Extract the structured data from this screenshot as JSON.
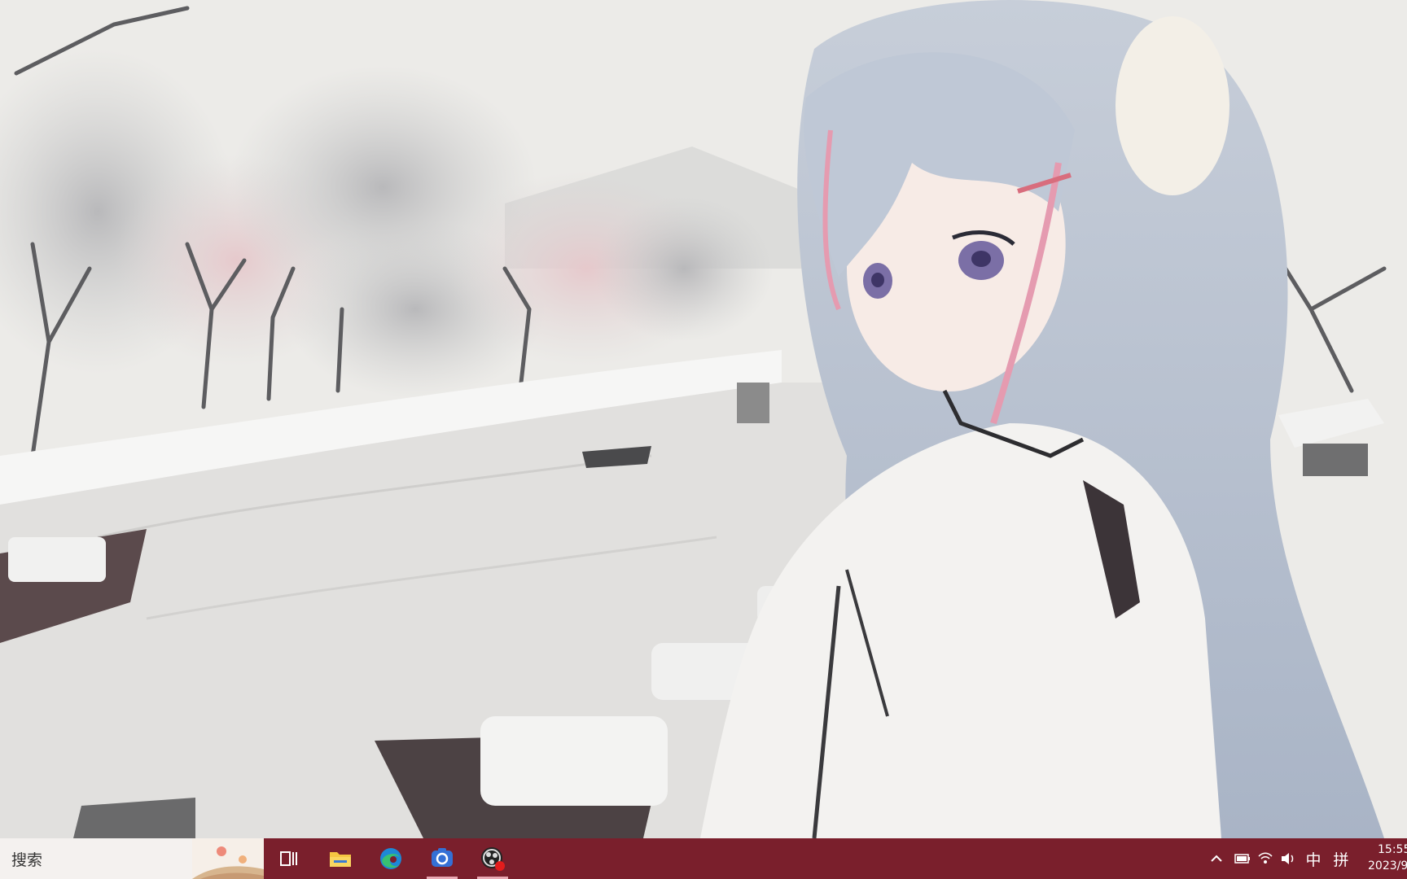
{
  "taskbar": {
    "search_placeholder": "搜索",
    "apps": [
      {
        "name": "task-view",
        "icon": "task-view-icon"
      },
      {
        "name": "file-explorer",
        "icon": "folder-icon"
      },
      {
        "name": "edge",
        "icon": "edge-browser-icon"
      },
      {
        "name": "screenshot-tool",
        "icon": "camera-icon",
        "active": true
      },
      {
        "name": "obs-recorder",
        "icon": "record-icon",
        "active": true
      }
    ],
    "tray": {
      "show_hidden_icon": "chevron-up-icon",
      "battery_icon": "battery-icon",
      "network_icon": "wifi-icon",
      "volume_icon": "speaker-icon",
      "ime_mode": "中",
      "ime_layout": "拼"
    },
    "clock": {
      "time": "15:55",
      "date": "2023/9"
    }
  },
  "colors": {
    "taskbar_bg": "#7a1f2c",
    "search_bg": "#f4f1ef",
    "active_indicator": "#e9a8b3"
  }
}
